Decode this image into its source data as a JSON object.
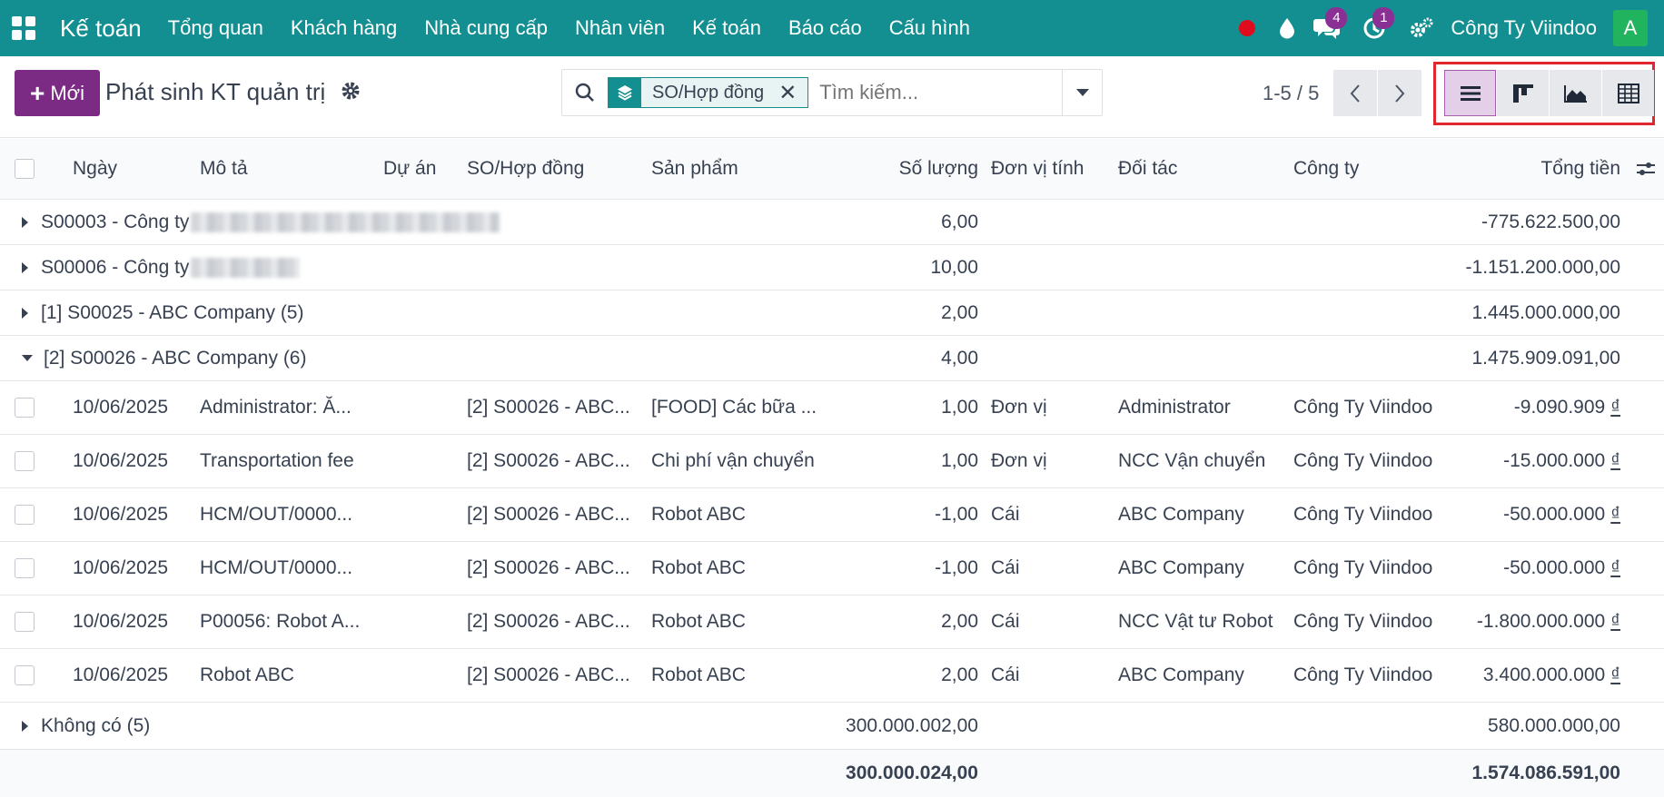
{
  "navbar": {
    "brand": "Kế toán",
    "menu": [
      "Tổng quan",
      "Khách hàng",
      "Nhà cung cấp",
      "Nhân viên",
      "Kế toán",
      "Báo cáo",
      "Cấu hình"
    ],
    "chat_badge": "4",
    "activity_badge": "1",
    "company": "Công Ty Viindoo",
    "avatar_letter": "A",
    "colors": {
      "bar": "#148f91",
      "record": "#e00b1d",
      "badge": "#8a2f94",
      "avatar": "#22b35e"
    }
  },
  "control": {
    "new_label": "Mới",
    "title": "Phát sinh KT quản trị",
    "facet_label": "SO/Hợp đồng",
    "search_placeholder": "Tìm kiếm...",
    "pager": "1-5 / 5",
    "views": [
      "list-view-icon",
      "kanban-view-icon",
      "graph-view-icon",
      "pivot-view-icon"
    ],
    "active_view": "list-view-icon"
  },
  "table": {
    "columns": [
      "Ngày",
      "Mô tả",
      "Dự án",
      "SO/Hợp đồng",
      "Sản phẩm",
      "Số lượng",
      "Đơn vị tính",
      "Đối tác",
      "Công ty",
      "Tổng tiền"
    ],
    "groups": [
      {
        "label": "S00003 - Công ty",
        "qty": "6,00",
        "total": "-775.622.500,00",
        "expanded": false
      },
      {
        "label": "S00006 - Công ty",
        "qty": "10,00",
        "total": "-1.151.200.000,00",
        "expanded": false
      },
      {
        "label": "[1] S00025 - ABC Company (5)",
        "qty": "2,00",
        "total": "1.445.000.000,00",
        "expanded": false
      },
      {
        "label": "[2] S00026 - ABC Company (6)",
        "qty": "4,00",
        "total": "1.475.909.091,00",
        "expanded": true
      }
    ],
    "rows": [
      {
        "date": "10/06/2025",
        "desc": "Administrator: Ă...",
        "project": "",
        "so": "[2] S00026 - ABC...",
        "product": "[FOOD] Các bữa ...",
        "qty": "1,00",
        "uom": "Đơn vị",
        "partner": "Administrator",
        "company": "Công Ty Viindoo",
        "total": "-9.090.909",
        "currency": "₫"
      },
      {
        "date": "10/06/2025",
        "desc": "Transportation fee",
        "project": "",
        "so": "[2] S00026 - ABC...",
        "product": "Chi phí vận chuyển",
        "qty": "1,00",
        "uom": "Đơn vị",
        "partner": "NCC Vận chuyển",
        "company": "Công Ty Viindoo",
        "total": "-15.000.000",
        "currency": "₫"
      },
      {
        "date": "10/06/2025",
        "desc": "HCM/OUT/0000...",
        "project": "",
        "so": "[2] S00026 - ABC...",
        "product": "Robot ABC",
        "qty": "-1,00",
        "uom": "Cái",
        "partner": "ABC Company",
        "company": "Công Ty Viindoo",
        "total": "-50.000.000",
        "currency": "₫"
      },
      {
        "date": "10/06/2025",
        "desc": "HCM/OUT/0000...",
        "project": "",
        "so": "[2] S00026 - ABC...",
        "product": "Robot ABC",
        "qty": "-1,00",
        "uom": "Cái",
        "partner": "ABC Company",
        "company": "Công Ty Viindoo",
        "total": "-50.000.000",
        "currency": "₫"
      },
      {
        "date": "10/06/2025",
        "desc": "P00056: Robot A...",
        "project": "",
        "so": "[2] S00026 - ABC...",
        "product": "Robot ABC",
        "qty": "2,00",
        "uom": "Cái",
        "partner": "NCC Vật tư Robot",
        "company": "Công Ty Viindoo",
        "total": "-1.800.000.000",
        "currency": "₫"
      },
      {
        "date": "10/06/2025",
        "desc": "Robot ABC",
        "project": "",
        "so": "[2] S00026 - ABC...",
        "product": "Robot ABC",
        "qty": "2,00",
        "uom": "Cái",
        "partner": "ABC Company",
        "company": "Công Ty Viindoo",
        "total": "3.400.000.000",
        "currency": "₫"
      }
    ],
    "none_group": {
      "label": "Không có (5)",
      "qty": "300.000.002,00",
      "total": "580.000.000,00"
    },
    "footer": {
      "qty": "300.000.024,00",
      "total": "1.574.086.591,00"
    }
  }
}
